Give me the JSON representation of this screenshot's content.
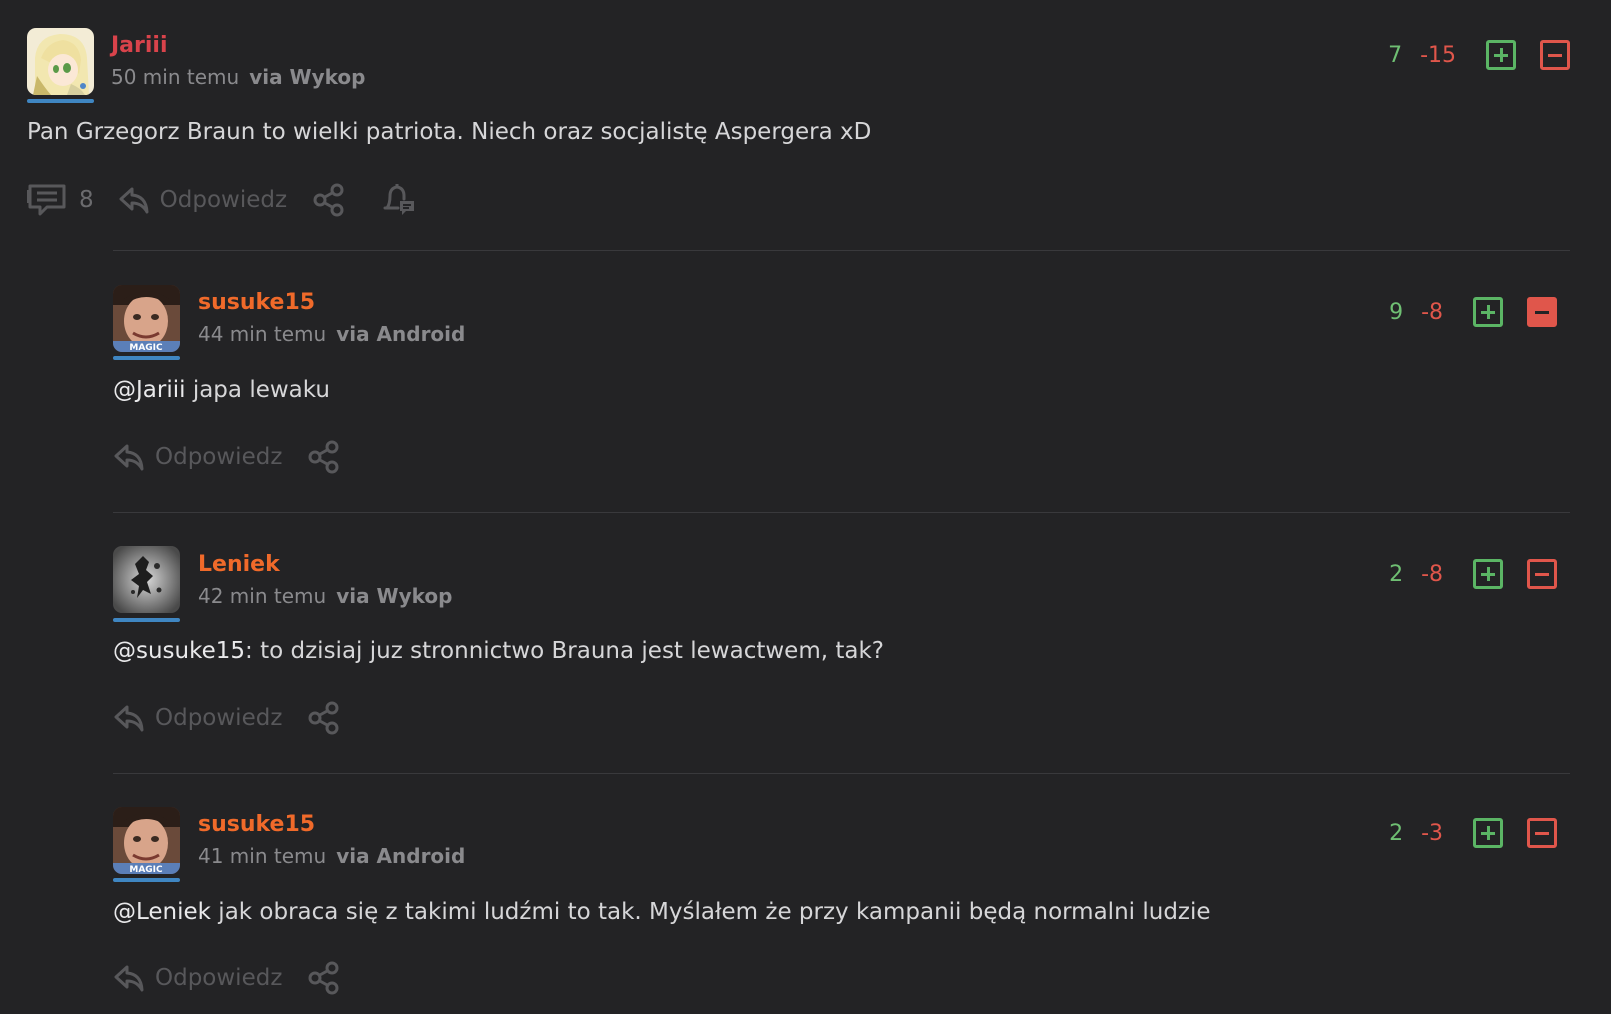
{
  "comments": [
    {
      "username": "Jariii",
      "username_color": "#d9434b",
      "time": "50 min temu",
      "via": "via Wykop",
      "mention": "",
      "text": "Pan Grzegorz Braun to wielki patriota. Niech oraz socjalistę Aspergera xD",
      "plus": "7",
      "minus": "-15",
      "downvoted": false,
      "comments_count": "8",
      "reply_label": "Odpowiedz",
      "avatar_icon": "anime-girl-avatar"
    },
    {
      "username": "susuke15",
      "username_color": "#f06a2a",
      "time": "44 min temu",
      "via": "via Android",
      "mention": "@Jariii",
      "text": " japa lewaku",
      "plus": "9",
      "minus": "-8",
      "downvoted": true,
      "reply_label": "Odpowiedz",
      "avatar_icon": "mr-bean-magic-avatar"
    },
    {
      "username": "Leniek",
      "username_color": "#f06a2a",
      "time": "42 min temu",
      "via": "via Wykop",
      "mention": "@susuke15",
      "text": ": to dzisiaj juz stronnictwo Brauna jest lewactwem, tak?",
      "plus": "2",
      "minus": "-8",
      "downvoted": false,
      "reply_label": "Odpowiedz",
      "avatar_icon": "ink-splash-avatar"
    },
    {
      "username": "susuke15",
      "username_color": "#f06a2a",
      "time": "41 min temu",
      "via": "via Android",
      "mention": "@Leniek",
      "text": " jak obraca się z takimi ludźmi to tak. Myślałem że przy kampanii będą normalni ludzie",
      "plus": "2",
      "minus": "-3",
      "downvoted": false,
      "reply_label": "Odpowiedz",
      "avatar_icon": "mr-bean-magic-avatar"
    }
  ],
  "colors": {
    "background": "#232325",
    "upvote": "#5bb565",
    "downvote": "#e0564b",
    "muted": "#58585b",
    "avatar_underline": "#3f86c2"
  }
}
